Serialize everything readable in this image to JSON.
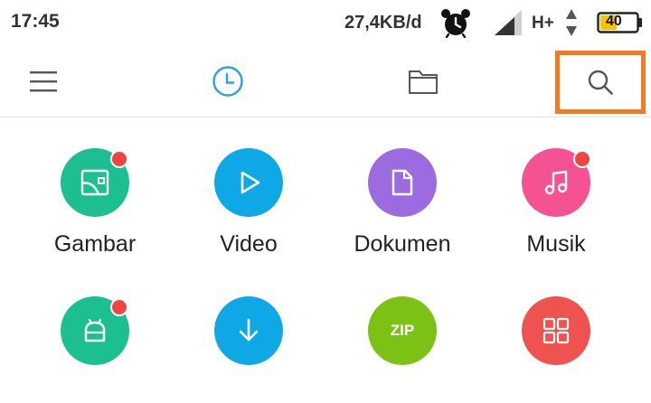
{
  "statusbar": {
    "time": "17:45",
    "speed": "27,4KB/d",
    "network": "H+",
    "battery": "40",
    "icons": [
      "alarm-icon",
      "signal-icon",
      "data-arrows-icon",
      "battery-icon"
    ]
  },
  "toolbar": {
    "icons": [
      "menu-icon",
      "recent-clock-icon",
      "folder-icon",
      "search-icon"
    ],
    "accent": "#2aa3dc",
    "highlight": "#f47920"
  },
  "categories": [
    {
      "label": "Gambar",
      "icon": "image-icon",
      "color": "#1cbf8f",
      "badge": true
    },
    {
      "label": "Video",
      "icon": "play-icon",
      "color": "#0fa8e6",
      "badge": false
    },
    {
      "label": "Dokumen",
      "icon": "document-icon",
      "color": "#9c6bdf",
      "badge": false
    },
    {
      "label": "Musik",
      "icon": "music-icon",
      "color": "#f55293",
      "badge": true
    },
    {
      "label": "",
      "icon": "apk-icon",
      "color": "#1cbf8f",
      "badge": true
    },
    {
      "label": "",
      "icon": "download-icon",
      "color": "#0fa8e6",
      "badge": false
    },
    {
      "label": "ZIP",
      "icon": "zip-icon",
      "color": "#7cc214",
      "badge": false
    },
    {
      "label": "",
      "icon": "apps-icon",
      "color": "#ef5350",
      "badge": false
    }
  ]
}
